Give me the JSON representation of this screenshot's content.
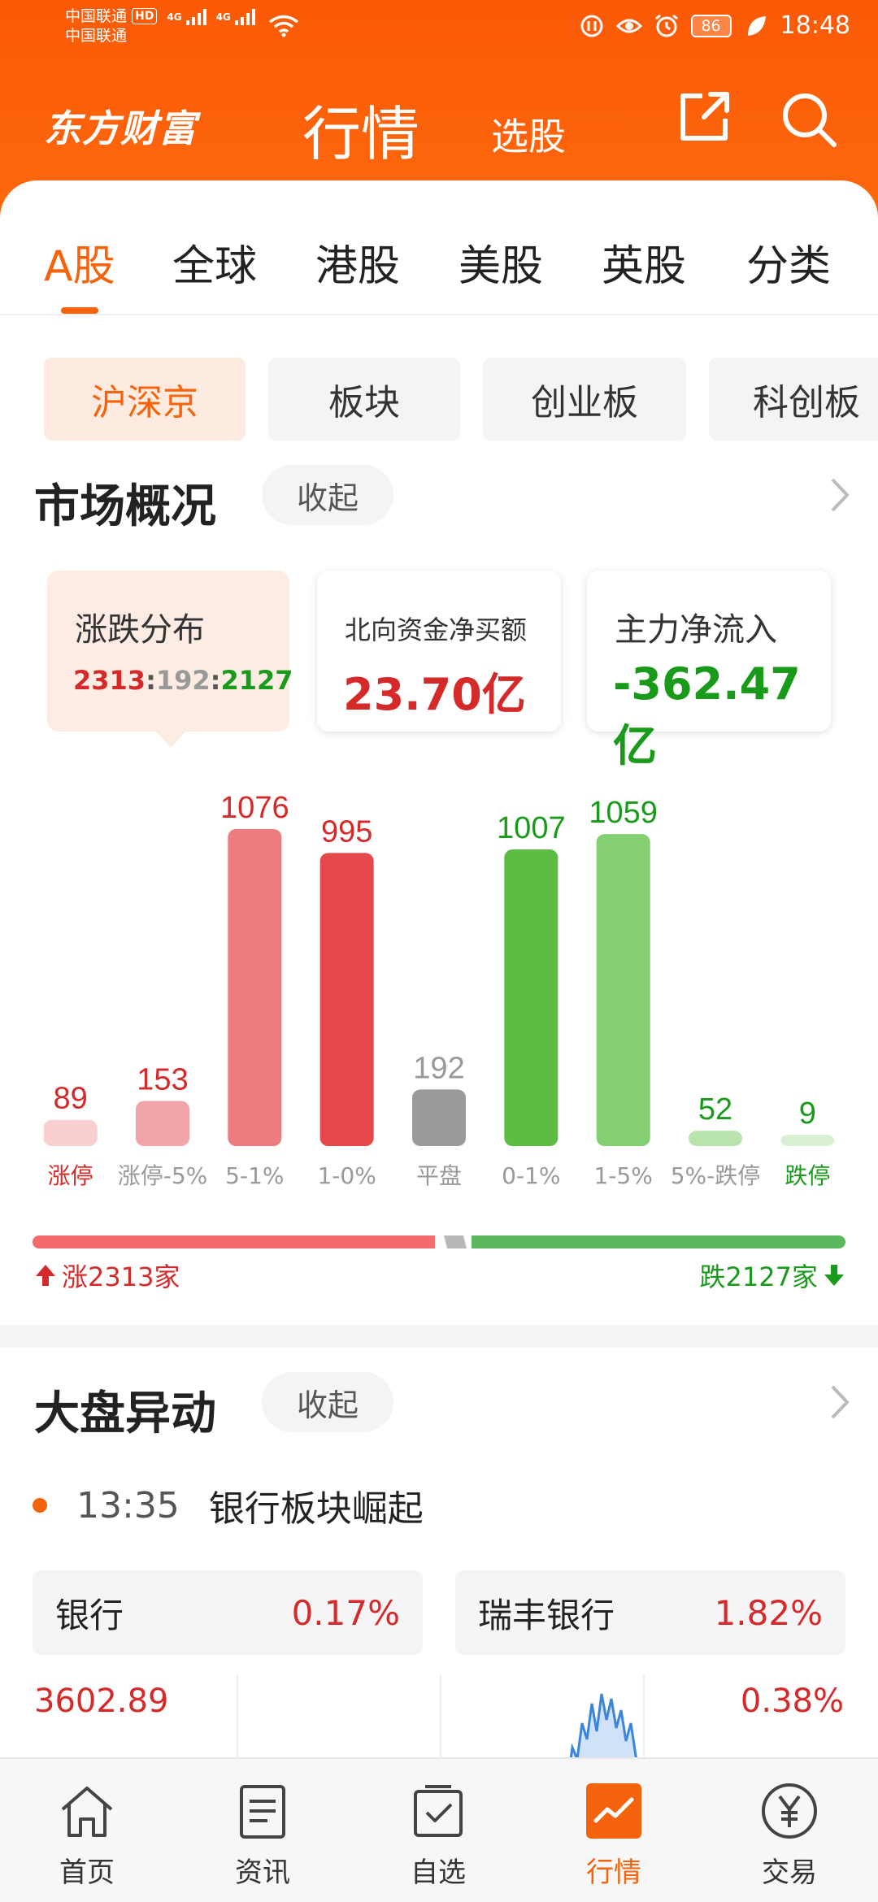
{
  "status_bar": {
    "carrier1": "中国联通",
    "carrier2": "中国联通",
    "hd": "HD",
    "net1": "4G",
    "net2": "4G",
    "battery": "86",
    "time": "18:48"
  },
  "header": {
    "brand": "东方财富",
    "title": "行情",
    "sub_nav": "选股"
  },
  "market_tabs": [
    "A股",
    "全球",
    "港股",
    "美股",
    "英股",
    "分类"
  ],
  "segment_chips": [
    "沪深京",
    "板块",
    "创业板",
    "科创板"
  ],
  "overview": {
    "title": "市场概况",
    "collapse_label": "收起",
    "cards": {
      "dist_label": "涨跌分布",
      "dist_up": "2313",
      "dist_flat": "192",
      "dist_down": "2127",
      "sep": ":",
      "northbound_label": "北向资金净买额",
      "northbound_value": "23.70亿",
      "main_flow_label": "主力净流入",
      "main_flow_value": "-362.47亿"
    },
    "up_summary": "涨2313家",
    "down_summary": "跌2127家"
  },
  "chart_data": {
    "type": "bar",
    "categories": [
      "涨停",
      "涨停-5%",
      "5-1%",
      "1-0%",
      "平盘",
      "0-1%",
      "1-5%",
      "5%-跌停",
      "跌停"
    ],
    "values": [
      89,
      153,
      1076,
      995,
      192,
      1007,
      1059,
      52,
      9
    ],
    "colors": [
      "#f8d0d0",
      "#f2a5a8",
      "#ee7b7d",
      "#e5484b",
      "#9a9a9a",
      "#5dbc44",
      "#85cf73",
      "#b9e3ad",
      "#d8efd2"
    ],
    "value_colors": [
      "#d52a2a",
      "#d52a2a",
      "#d52a2a",
      "#d52a2a",
      "#999999",
      "#1a9a1a",
      "#1a9a1a",
      "#1a9a1a",
      "#1a9a1a"
    ],
    "label_colors": [
      "#d52a2a",
      "#999999",
      "#999999",
      "#999999",
      "#999999",
      "#999999",
      "#999999",
      "#999999",
      "#1a9a1a"
    ]
  },
  "movement": {
    "title": "大盘异动",
    "collapse_label": "收起",
    "event_time": "13:35",
    "event_text": "银行板块崛起",
    "sector_name": "银行",
    "sector_pct": "0.17%",
    "stock_name": "瑞丰银行",
    "stock_pct": "1.82%",
    "index_value": "3602.89",
    "index_pct": "0.38%"
  },
  "bottom_nav": [
    "首页",
    "资讯",
    "自选",
    "行情",
    "交易"
  ],
  "colors": {
    "brand_orange": "#f5640c",
    "up_red": "#d52a2a",
    "down_green": "#1a9a1a"
  }
}
